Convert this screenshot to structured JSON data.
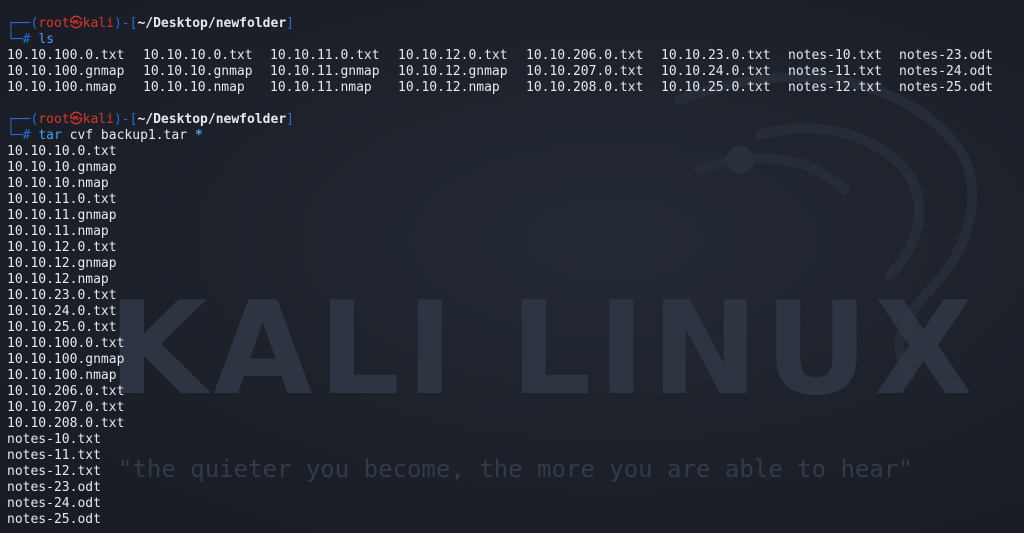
{
  "wallpaper": {
    "logo": "KALI LINUX",
    "quote": "\"the quieter you become, the more you are able to hear\""
  },
  "prompt": {
    "top_left": "┌──(",
    "user": "root",
    "skull": "㉿",
    "host": "kali",
    "mid": ")-[",
    "path": "~/Desktop/newfolder",
    "close": "]",
    "bottom": "└─",
    "hash": "#"
  },
  "command1": {
    "name": "ls",
    "output": [
      [
        "10.10.100.0.txt",
        "10.10.10.0.txt",
        "10.10.11.0.txt",
        "10.10.12.0.txt",
        "10.10.206.0.txt",
        "10.10.23.0.txt",
        "notes-10.txt",
        "notes-23.odt"
      ],
      [
        "10.10.100.gnmap",
        "10.10.10.gnmap",
        "10.10.11.gnmap",
        "10.10.12.gnmap",
        "10.10.207.0.txt",
        "10.10.24.0.txt",
        "notes-11.txt",
        "notes-24.odt"
      ],
      [
        "10.10.100.nmap",
        "10.10.10.nmap",
        "10.10.11.nmap",
        "10.10.12.nmap",
        "10.10.208.0.txt",
        "10.10.25.0.txt",
        "notes-12.txt",
        "notes-25.odt"
      ]
    ]
  },
  "command2": {
    "name": "tar",
    "args": "cvf backup1.tar",
    "glob": "*",
    "output": [
      "10.10.10.0.txt",
      "10.10.10.gnmap",
      "10.10.10.nmap",
      "10.10.11.0.txt",
      "10.10.11.gnmap",
      "10.10.11.nmap",
      "10.10.12.0.txt",
      "10.10.12.gnmap",
      "10.10.12.nmap",
      "10.10.23.0.txt",
      "10.10.24.0.txt",
      "10.10.25.0.txt",
      "10.10.100.0.txt",
      "10.10.100.gnmap",
      "10.10.100.nmap",
      "10.10.206.0.txt",
      "10.10.207.0.txt",
      "10.10.208.0.txt",
      "notes-10.txt",
      "notes-11.txt",
      "notes-12.txt",
      "notes-23.odt",
      "notes-24.odt",
      "notes-25.odt"
    ]
  },
  "colors": {
    "background": "#1c2029",
    "prompt_box": "#2b6cd8",
    "user_host": "#d8372a",
    "command": "#4f9cf0",
    "text": "#e6e9ee"
  }
}
